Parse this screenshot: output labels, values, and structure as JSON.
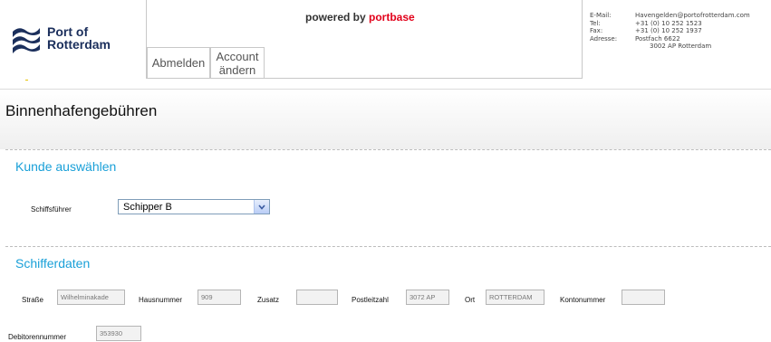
{
  "header": {
    "logo_line1": "Port of",
    "logo_line2": "Rotterdam",
    "powered_prefix": "powered by ",
    "powered_brand": "portbase",
    "nav": {
      "logout": "Abmelden",
      "account_line1": "Account",
      "account_line2": "ändern"
    },
    "contact": {
      "email_label": "E-Mail:",
      "email": "Havengelden@portofrotterdam.com",
      "tel_label": "Tel:",
      "tel": "+31 (0) 10 252 1523",
      "fax_label": "Fax:",
      "fax": "+31 (0) 10 252 1937",
      "address_label": "Adresse:",
      "address1": "Postfach 6622",
      "address2": "3002 AP  Rotterdam"
    }
  },
  "page": {
    "title": "Binnenhafengebühren"
  },
  "customer": {
    "section_title": "Kunde auswählen",
    "skipper_label": "Schiffsführer",
    "skipper_value": "Schipper B"
  },
  "skipper_data": {
    "section_title": "Schifferdaten",
    "street_label": "Straße",
    "street": "Wilhelminakade",
    "house_label": "Hausnummer",
    "house": "909",
    "addition_label": "Zusatz",
    "addition": "",
    "postal_label": "Postleitzahl",
    "postal": "3072 AP",
    "city_label": "Ort",
    "city": "ROTTERDAM",
    "account_label": "Kontonummer",
    "account": "",
    "debtor_label": "Debitorennummer",
    "debtor": "353930"
  },
  "colors": {
    "accent": "#1aa0d8",
    "brand_red": "#e2001a",
    "logo_blue": "#1b2f5c"
  }
}
